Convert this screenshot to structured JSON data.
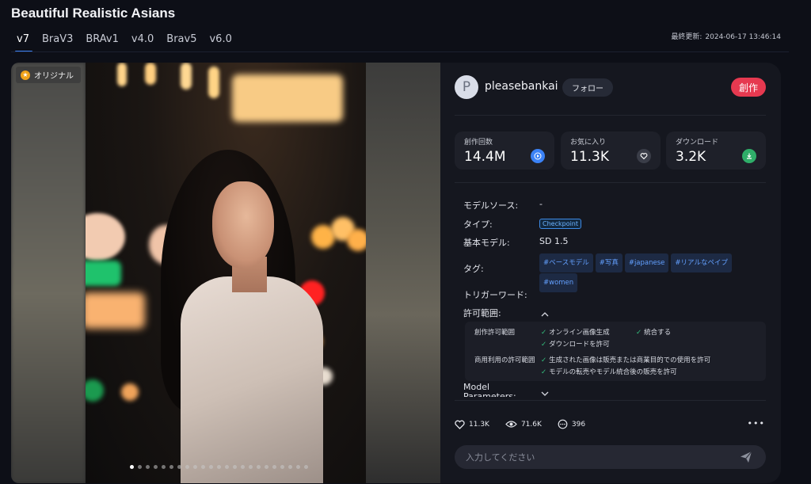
{
  "page": {
    "title": "Beautiful Realistic Asians"
  },
  "tabs": [
    {
      "label": "v7",
      "active": true
    },
    {
      "label": "BraV3"
    },
    {
      "label": "BRAv1"
    },
    {
      "label": "v4.0"
    },
    {
      "label": "Brav5"
    },
    {
      "label": "v6.0"
    }
  ],
  "updated": {
    "label": "最終更新:",
    "value": "2024-06-17 13:46:14"
  },
  "gallery": {
    "badge": "オリジナル",
    "dot_count": 23,
    "active_dot": 0
  },
  "author": {
    "avatar_letter": "P",
    "name": "pleasebankai",
    "follow_label": "フォロー",
    "create_label": "創作"
  },
  "stats": [
    {
      "label": "創作回数",
      "value": "14.4M",
      "icon": "play-icon",
      "color": "#3b82f6"
    },
    {
      "label": "お気に入り",
      "value": "11.3K",
      "icon": "heart-icon",
      "color": "#3a3d48"
    },
    {
      "label": "ダウンロード",
      "value": "3.2K",
      "icon": "download-icon",
      "color": "#2fae69"
    }
  ],
  "details": {
    "model_source": {
      "label": "モデルソース:",
      "value": "-"
    },
    "type": {
      "label": "タイプ:",
      "value": "Checkpoint"
    },
    "base_model": {
      "label": "基本モデル:",
      "value": "SD 1.5"
    },
    "tags_label": "タグ:",
    "tags": [
      "#ベースモデル",
      "#写真",
      "#japanese",
      "#リアルなペイプ",
      "#women"
    ],
    "trigger": {
      "label": "トリガーワード:"
    },
    "permission": {
      "label": "許可範囲:"
    },
    "model_params": {
      "label": "Model Parameters:"
    }
  },
  "permissions": {
    "creation_label": "創作許可範囲",
    "creation_items": [
      "オンライン画像生成",
      "統合する",
      "ダウンロードを許可"
    ],
    "commercial_label": "商用利用の許可範囲",
    "commercial_items": [
      "生成された画像は販売または商業目的での使用を許可",
      "モデルの転売やモデル統合後の販売を許可"
    ]
  },
  "footer": {
    "likes": "11.3K",
    "views": "71.6K",
    "comments": "396",
    "comment_placeholder": "入力してください"
  }
}
